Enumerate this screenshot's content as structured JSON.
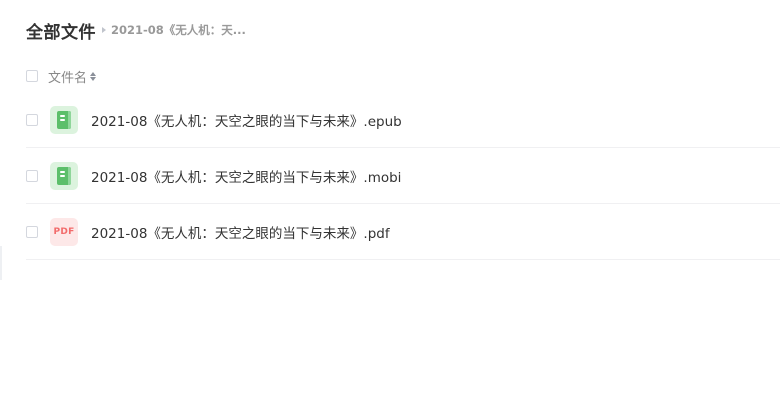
{
  "breadcrumb": {
    "root": "全部文件",
    "current": "2021-08《无人机：天..."
  },
  "list_header": {
    "column_name": "文件名",
    "sort_icon": "sort-icon"
  },
  "files": [
    {
      "name": "2021-08《无人机：天空之眼的当下与未来》.epub",
      "icon": "book-icon",
      "icon_color": "#5cbf6a"
    },
    {
      "name": "2021-08《无人机：天空之眼的当下与未来》.mobi",
      "icon": "book-icon",
      "icon_color": "#5cbf6a"
    },
    {
      "name": "2021-08《无人机：天空之眼的当下与未来》.pdf",
      "icon": "pdf-icon",
      "icon_label": "PDF",
      "icon_color": "#f26b6b"
    }
  ]
}
